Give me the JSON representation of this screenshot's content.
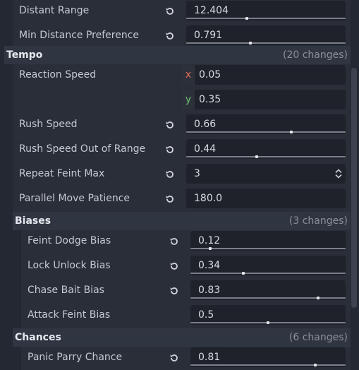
{
  "colors": {
    "background": "#242833",
    "section_bg": "#303542",
    "axis_x": "#e06c5c",
    "axis_y": "#6fbf73"
  },
  "rows_top": [
    {
      "label": "Distant Range",
      "value": "12.404",
      "fraction": 0.38
    },
    {
      "label": "Min Distance Preference",
      "value": "0.791",
      "fraction": 0.4
    }
  ],
  "tempo": {
    "title": "Tempo",
    "changes": "(20 changes)",
    "reaction_speed": {
      "label": "Reaction Speed",
      "x_axis": "x",
      "x_value": "0.05",
      "y_axis": "y",
      "y_value": "0.35"
    },
    "rush_speed": {
      "label": "Rush Speed",
      "value": "0.66",
      "fraction": 0.66
    },
    "rush_speed_oor": {
      "label": "Rush Speed Out of Range",
      "value": "0.44",
      "fraction": 0.44
    },
    "repeat_feint_max": {
      "label": "Repeat Feint Max",
      "value": "3"
    },
    "parallel_move_patience": {
      "label": "Parallel Move Patience",
      "value": "180.0"
    }
  },
  "biases": {
    "title": "Biases",
    "changes": "(3 changes)",
    "feint_dodge": {
      "label": "Feint Dodge Bias",
      "value": "0.12",
      "fraction": 0.12
    },
    "lock_unlock": {
      "label": "Lock Unlock Bias",
      "value": "0.34",
      "fraction": 0.34
    },
    "chase_bait": {
      "label": "Chase Bait Bias",
      "value": "0.83",
      "fraction": 0.83
    },
    "attack_feint": {
      "label": "Attack Feint Bias",
      "value": "0.5",
      "fraction": 0.5
    }
  },
  "chances": {
    "title": "Chances",
    "changes": "(6 changes)",
    "panic_parry": {
      "label": "Panic Parry Chance",
      "value": "0.81",
      "fraction": 0.81
    }
  }
}
